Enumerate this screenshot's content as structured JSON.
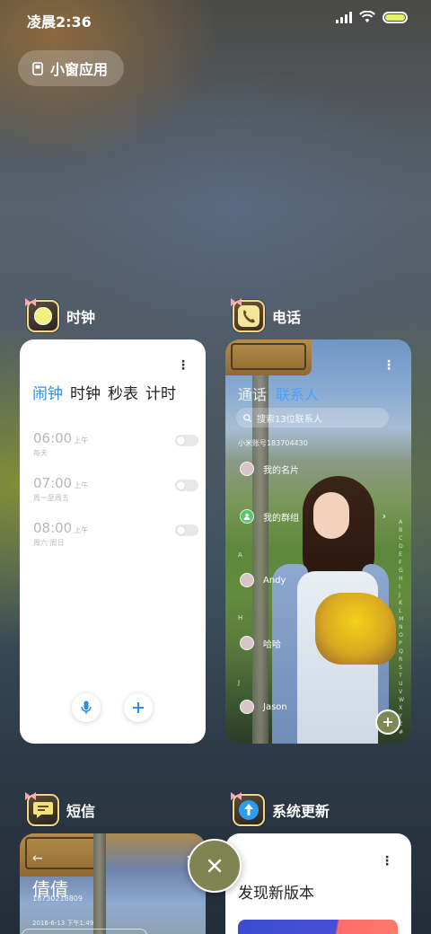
{
  "status_bar": {
    "time": "凌晨2:36"
  },
  "floating_windows": {
    "label": "小窗应用"
  },
  "apps": {
    "clock": {
      "name": "时钟",
      "tabs": [
        "闹钟",
        "时钟",
        "秒表",
        "计时"
      ],
      "active_tab": "闹钟",
      "alarms": [
        {
          "time": "06:00",
          "period": "上午",
          "repeat": "每天",
          "enabled": false
        },
        {
          "time": "07:00",
          "period": "上午",
          "repeat": "周一至周五",
          "enabled": false
        },
        {
          "time": "08:00",
          "period": "上午",
          "repeat": "周六 周日",
          "enabled": false
        }
      ]
    },
    "phone": {
      "name": "电话",
      "tabs": [
        "通话",
        "联系人"
      ],
      "active_tab": "联系人",
      "search_placeholder": "搜索13位联系人",
      "account": "小米账号183704430",
      "entries": [
        {
          "label": "我的名片",
          "letter": ""
        },
        {
          "label": "我的群组",
          "letter": ""
        },
        {
          "label": "Andy",
          "letter": "A"
        },
        {
          "label": "哈哈",
          "letter": "H"
        },
        {
          "label": "Jason",
          "letter": "J"
        }
      ],
      "index_letters": [
        "A",
        "B",
        "C",
        "D",
        "E",
        "F",
        "G",
        "H",
        "I",
        "J",
        "K",
        "L",
        "M",
        "N",
        "O",
        "P",
        "Q",
        "R",
        "S",
        "T",
        "U",
        "V",
        "W",
        "X",
        "Y",
        "Z",
        "#"
      ]
    },
    "messages": {
      "name": "短信",
      "contact_name": "倩倩",
      "number": "18730218809",
      "date": "2016-6-13 下午1:49"
    },
    "system_update": {
      "name": "系统更新",
      "title": "发现新版本"
    }
  },
  "colors": {
    "accent_blue": "#2a8ef0",
    "close_button": "#7f8452",
    "battery_fill": "#e7f06a"
  },
  "icons": {
    "close": "close-icon",
    "floating": "floating-window-icon"
  }
}
